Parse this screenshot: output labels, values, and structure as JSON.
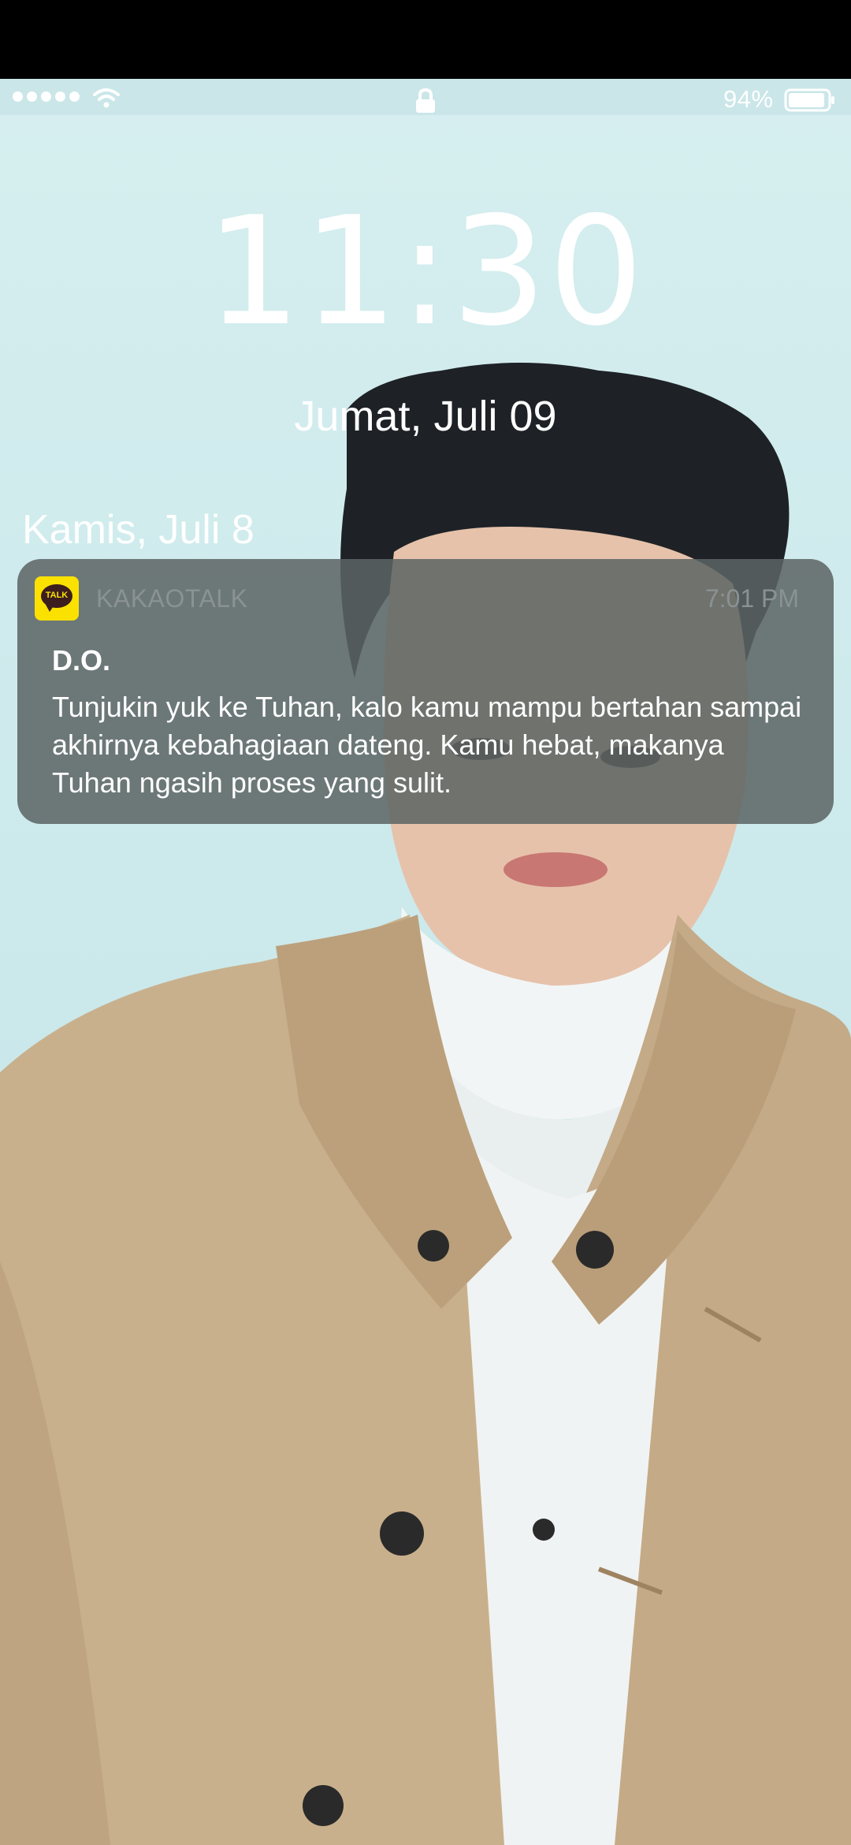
{
  "status_bar": {
    "battery_percent": "94%",
    "signal_bars": 5,
    "battery_level": 0.94,
    "icons": [
      "signal-dots-icon",
      "wifi-icon",
      "lock-icon",
      "battery-icon"
    ]
  },
  "lock_screen": {
    "time": "11:30",
    "date": "Jumat, Juli 09"
  },
  "notifications": {
    "section_title": "Kamis, Juli 8",
    "items": [
      {
        "app_name": "KAKAOTALK",
        "app_icon_text": "TALK",
        "time": "7:01 PM",
        "sender": "D.O.",
        "message": "Tunjukin yuk ke Tuhan, kalo kamu mampu bertahan sampai akhirnya kebahagiaan dateng. Kamu hebat, makanya Tuhan ngasih proses yang sulit."
      }
    ]
  },
  "colors": {
    "wallpaper_bg": "#cdeaec",
    "notif_bg": "#5c6464",
    "kakao_yellow": "#fae100",
    "coat": "#c9b08c"
  }
}
